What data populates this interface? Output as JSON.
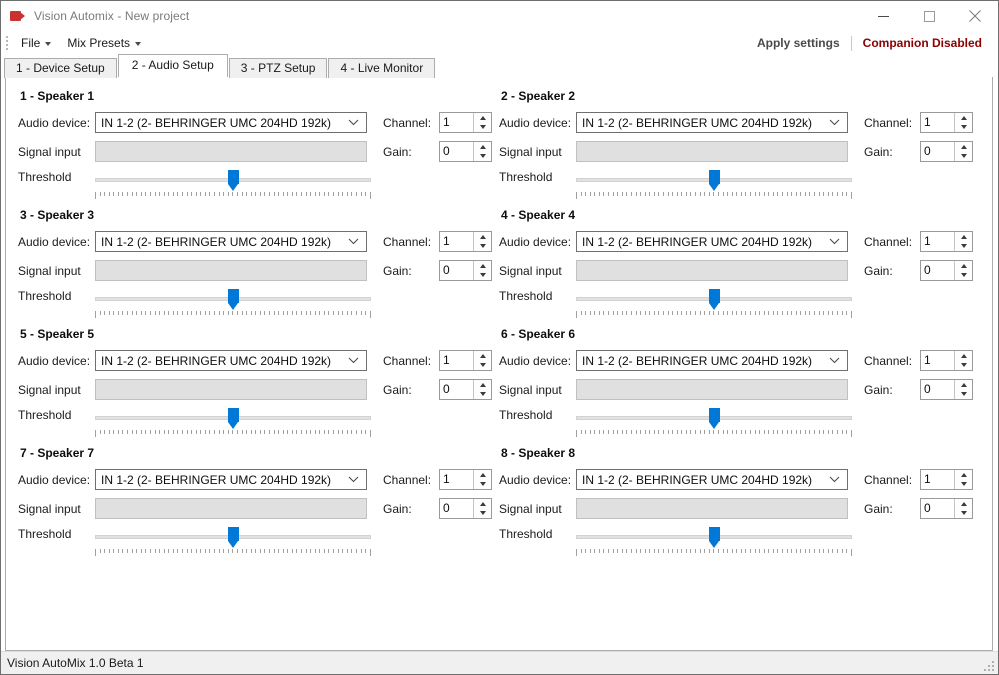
{
  "window": {
    "title": "Vision Automix - New project",
    "icon": "video-camera-icon",
    "minimize_label": "Minimize",
    "maximize_label": "Maximize",
    "close_label": "Close"
  },
  "menubar": {
    "items": [
      {
        "label": "File"
      },
      {
        "label": "Mix Presets"
      }
    ],
    "apply_settings_label": "Apply settings",
    "companion_status": "Companion Disabled",
    "companion_status_color": "#8b0000"
  },
  "tabs": [
    {
      "label": "1 - Device Setup",
      "active": false
    },
    {
      "label": "2 - Audio Setup",
      "active": true
    },
    {
      "label": "3 - PTZ Setup",
      "active": false
    },
    {
      "label": "4 - Live Monitor",
      "active": false
    }
  ],
  "labels": {
    "audio_device": "Audio device:",
    "signal_input": "Signal input",
    "threshold": "Threshold",
    "channel": "Channel:",
    "gain": "Gain:"
  },
  "accent_color": "#0078d7",
  "speakers": [
    {
      "title": "1 - Speaker 1",
      "audio_device": "IN 1-2 (2- BEHRINGER UMC 204HD 192k)",
      "signal_input_value": "",
      "channel": "1",
      "gain": "0",
      "threshold_percent": 50
    },
    {
      "title": "2 - Speaker 2",
      "audio_device": "IN 1-2 (2- BEHRINGER UMC 204HD 192k)",
      "signal_input_value": "",
      "channel": "1",
      "gain": "0",
      "threshold_percent": 50
    },
    {
      "title": "3 - Speaker 3",
      "audio_device": "IN 1-2 (2- BEHRINGER UMC 204HD 192k)",
      "signal_input_value": "",
      "channel": "1",
      "gain": "0",
      "threshold_percent": 50
    },
    {
      "title": "4 - Speaker 4",
      "audio_device": "IN 1-2 (2- BEHRINGER UMC 204HD 192k)",
      "signal_input_value": "",
      "channel": "1",
      "gain": "0",
      "threshold_percent": 50
    },
    {
      "title": "5 - Speaker 5",
      "audio_device": "IN 1-2 (2- BEHRINGER UMC 204HD 192k)",
      "signal_input_value": "",
      "channel": "1",
      "gain": "0",
      "threshold_percent": 50
    },
    {
      "title": "6 - Speaker 6",
      "audio_device": "IN 1-2 (2- BEHRINGER UMC 204HD 192k)",
      "signal_input_value": "",
      "channel": "1",
      "gain": "0",
      "threshold_percent": 50
    },
    {
      "title": "7 - Speaker 7",
      "audio_device": "IN 1-2 (2- BEHRINGER UMC 204HD 192k)",
      "signal_input_value": "",
      "channel": "1",
      "gain": "0",
      "threshold_percent": 50
    },
    {
      "title": "8 - Speaker 8",
      "audio_device": "IN 1-2 (2- BEHRINGER UMC 204HD 192k)",
      "signal_input_value": "",
      "channel": "1",
      "gain": "0",
      "threshold_percent": 50
    }
  ],
  "statusbar": {
    "text": "Vision AutoMix 1.0 Beta 1"
  }
}
